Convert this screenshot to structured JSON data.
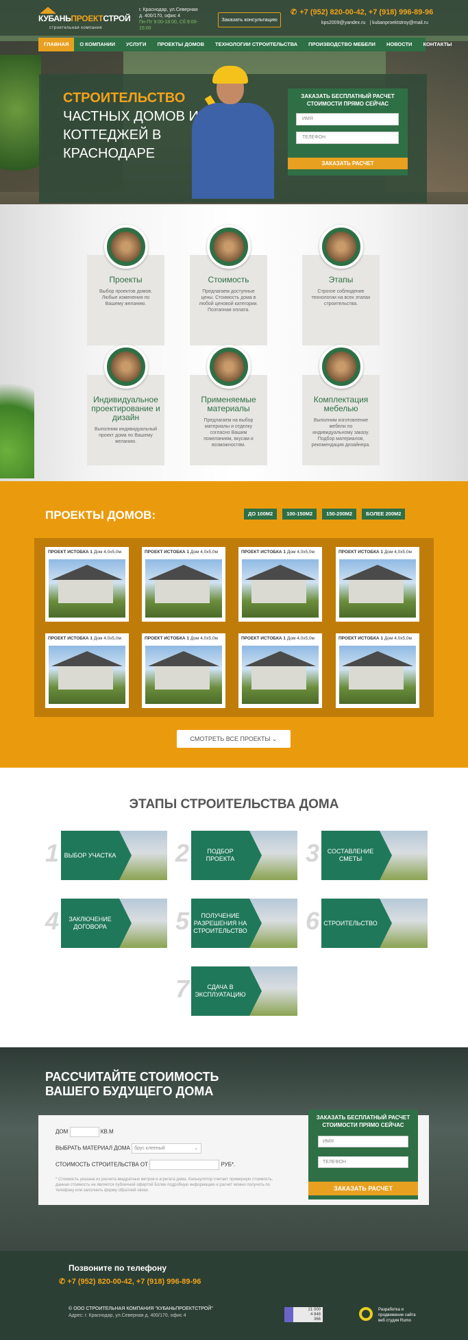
{
  "header": {
    "logo_part1": "КУБАНЬ",
    "logo_part2": "ПРОЕКТ",
    "logo_part3": "СТРОЙ",
    "logo_sub": "строительная компания",
    "address_line1": "г. Краснодар, ул.Северная",
    "address_line2": "д. 400/170, офис 4",
    "hours": "Пн-Пт 9:00-18:00, Сб 9:00-15:00",
    "consult_button": "Заказать консультацию",
    "phones": "+7 (952) 820-00-42, +7 (918) 996-89-96",
    "email1": "kps2009@yandex.ru",
    "email2": "kubanproektstroy@mail.ru"
  },
  "nav": {
    "items": [
      "Главная",
      "О компании",
      "Услуги",
      "Проекты домов",
      "Технологии строительства",
      "Производство мебели",
      "Новости",
      "Контакты"
    ]
  },
  "hero": {
    "title_highlight": "СТРОИТЕЛЬСТВО",
    "title_rest": "ЧАСТНЫХ ДОМОВ И КОТТЕДЖЕЙ В КРАСНОДАРЕ",
    "form_title": "ЗАКАЗАТЬ БЕСПЛАТНЫЙ РАСЧЕТ СТОИМОСТИ ПРЯМО СЕЙЧАС",
    "name_placeholder": "имя",
    "phone_placeholder": "телефон",
    "submit": "ЗАКАЗАТЬ РАСЧЕТ"
  },
  "features": [
    {
      "title": "Проекты",
      "text": "Выбор проектов домов. Любые изменения по Вашему желанию."
    },
    {
      "title": "Стоимость",
      "text": "Предлагаем доступные цены. Стоимость дома в любой ценовой категории. Поэтапная оплата."
    },
    {
      "title": "Этапы",
      "text": "Строгое соблюдение технологии на всех этапах строительства."
    },
    {
      "title": "Индивидуальное проектирование и дизайн",
      "text": "Выполним индивидуальный проект дома по Вашему желанию."
    },
    {
      "title": "Применяемые материалы",
      "text": "Предлагаем на выбор материалы и отделку согласно Вашим пожеланиям, вкусам и возможностям."
    },
    {
      "title": "Комплектация мебелью",
      "text": "Выполним изготовление мебели по индивидуальному заказу. Подбор материалов, рекомендация дизайнера."
    }
  ],
  "projects": {
    "title": "ПРОЕКТЫ ДОМОВ:",
    "filters": [
      "ДО 100М2",
      "100-150М2",
      "150-200М2",
      "БОЛЕЕ 200М2"
    ],
    "cards": [
      {
        "name": "ПРОЕКТ ИСТОБКА 1",
        "size": "Дом 4,0x5,0м"
      },
      {
        "name": "ПРОЕКТ ИСТОБКА 1",
        "size": "Дом 4,0x5,0м"
      },
      {
        "name": "ПРОЕКТ ИСТОБКА 1",
        "size": "Дом 4,0x5,0м"
      },
      {
        "name": "ПРОЕКТ ИСТОБКА 1",
        "size": "Дом 4,0x5,0м"
      },
      {
        "name": "ПРОЕКТ ИСТОБКА 1",
        "size": "Дом 4,0x5,0м"
      },
      {
        "name": "ПРОЕКТ ИСТОБКА 1",
        "size": "Дом 4,0x5,0м"
      },
      {
        "name": "ПРОЕКТ ИСТОБКА 1",
        "size": "Дом 4,0x5,0м"
      },
      {
        "name": "ПРОЕКТ ИСТОБКА 1",
        "size": "Дом 4,0x5,0м"
      }
    ],
    "all_button": "СМОТРЕТЬ ВСЕ ПРОЕКТЫ"
  },
  "stages": {
    "title": "ЭТАПЫ СТРОИТЕЛЬСТВА ДОМА",
    "items": [
      {
        "num": "1",
        "label": "ВЫБОР УЧАСТКА"
      },
      {
        "num": "2",
        "label": "ПОДБОР ПРОЕКТА"
      },
      {
        "num": "3",
        "label": "СОСТАВЛЕНИЕ СМЕТЫ"
      },
      {
        "num": "4",
        "label": "ЗАКЛЮЧЕНИЕ ДОГОВОРА"
      },
      {
        "num": "5",
        "label": "ПОЛУЧЕНИЕ РАЗРЕШЕНИЯ НА СТРОИТЕЛЬСТВО"
      },
      {
        "num": "6",
        "label": "СТРОИТЕЛЬСТВО"
      },
      {
        "num": "7",
        "label": "СДАЧА В ЭКСПЛУАТАЦИЮ"
      }
    ]
  },
  "calc": {
    "title_line1": "РАССЧИТАЙТЕ СТОИМОСТЬ",
    "title_line2": "ВАШЕГО БУДУЩЕГО ДОМА",
    "house_label": "ДОМ",
    "house_unit": "КВ.М",
    "material_label": "ВЫБРАТЬ МАТЕРИАЛ ДОМА",
    "material_value": "брус клееный",
    "cost_label": "СТОИМОСТЬ СТРОИТЕЛЬСТВА ОТ",
    "cost_unit": "РУБ*.",
    "note": "* Стоимость указана из расчета квадратных метров и агрегата дома. Калькулятор считает примерную стоимость, данная стоимость не является публичной офертой Более подробную информацию и расчет можно получить по телефону или заполнить форму обратной связи.",
    "form_title": "ЗАКАЗАТЬ БЕСПЛАТНЫЙ РАСЧЕТ СТОИМОСТИ ПРЯМО СЕЙЧАС",
    "name_placeholder": "имя",
    "phone_placeholder": "телефон",
    "submit": "ЗАКАЗАТЬ РАСЧЕТ"
  },
  "footer": {
    "call": "Позвоните по телефону",
    "phones": "+7 (952) 820-00-42, +7 (918) 996-89-96",
    "copyright": "© ООО СТРОИТЕЛЬНАЯ КОМПАНИЯ \"КУБАНЬПРОЕКТСТРОЙ\"",
    "address": "Адрес: г. Краснодар, ул.Северная д. 400/170, офис 4",
    "counter_1": "21 000",
    "counter_2": "4 848",
    "counter_3": "366",
    "dev": "Разработка и продвижение сайта веб студия Rumo"
  },
  "colors": {
    "accent": "#e8a020",
    "green": "#2f6f46",
    "projects_bg": "#ea9b0d"
  }
}
